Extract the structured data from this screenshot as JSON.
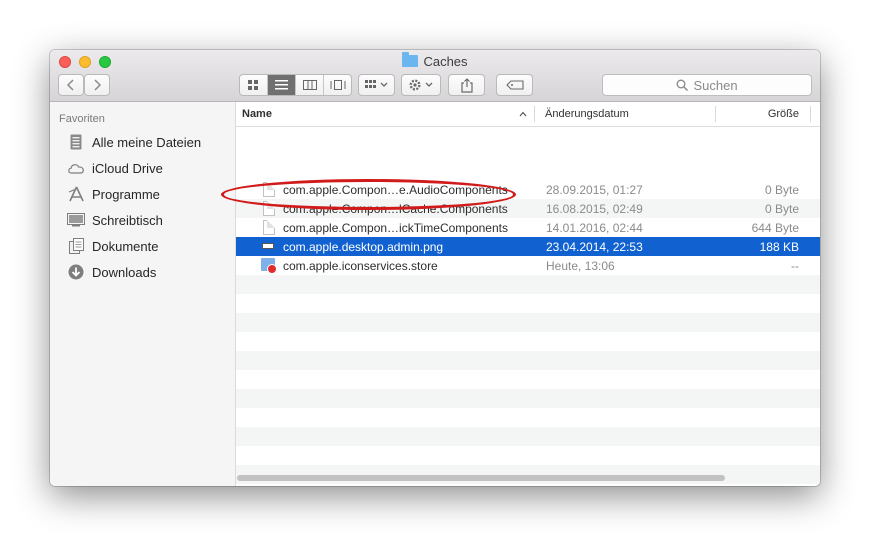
{
  "window": {
    "title": "Caches"
  },
  "toolbar": {
    "back_icon": "chevron-left",
    "forward_icon": "chevron-right",
    "view_modes": [
      "icon-view",
      "list-view",
      "column-view",
      "cover-flow-view"
    ],
    "active_view": "list-view",
    "search_placeholder": "Suchen"
  },
  "sidebar": {
    "heading": "Favoriten",
    "items": [
      {
        "label": "Alle meine Dateien",
        "icon": "all-files-icon"
      },
      {
        "label": "iCloud Drive",
        "icon": "cloud-icon"
      },
      {
        "label": "Programme",
        "icon": "applications-icon"
      },
      {
        "label": "Schreibtisch",
        "icon": "desktop-icon"
      },
      {
        "label": "Dokumente",
        "icon": "documents-icon"
      },
      {
        "label": "Downloads",
        "icon": "downloads-icon"
      }
    ]
  },
  "table": {
    "columns": {
      "name": "Name",
      "date": "Änderungsdatum",
      "size": "Größe"
    },
    "sort_indicator": "^",
    "rows": [
      {
        "name": "com.apple.Compon…e.AudioComponents",
        "date": "28.09.2015, 01:27",
        "size": "0 Byte",
        "icon": "document-icon"
      },
      {
        "name": "com.apple.Compon…lCache.Components",
        "date": "16.08.2015, 02:49",
        "size": "0 Byte",
        "icon": "document-icon"
      },
      {
        "name": "com.apple.Compon…ickTimeComponents",
        "date": "14.01.2016, 02:44",
        "size": "644 Byte",
        "icon": "document-icon"
      },
      {
        "name": "com.apple.desktop.admin.png",
        "date": "23.04.2014, 22:53",
        "size": "188 KB",
        "icon": "png-image-icon",
        "selected": true
      },
      {
        "name": "com.apple.iconservices.store",
        "date": "Heute, 13:06",
        "size": "--",
        "icon": "restricted-folder-icon"
      }
    ]
  },
  "colors": {
    "selection": "#1162d0",
    "annotation": "#d11a1a"
  }
}
